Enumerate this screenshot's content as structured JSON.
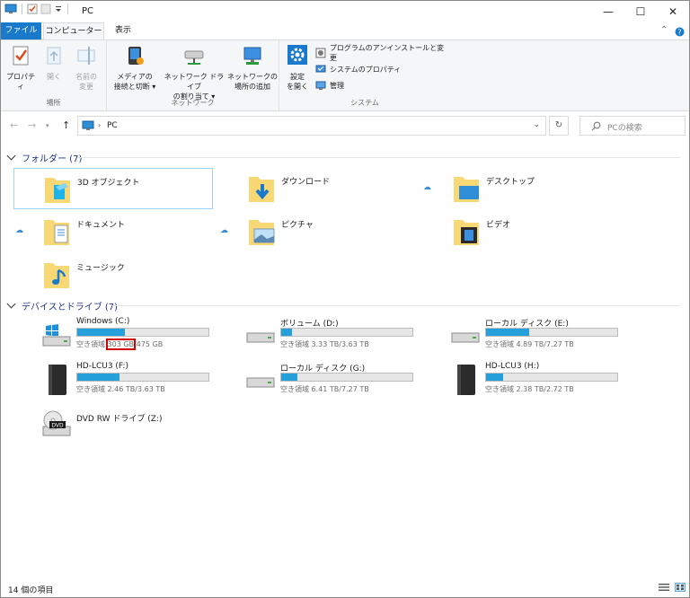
{
  "window": {
    "title": "PC",
    "controls": {
      "minimize": "—",
      "maximize": "☐",
      "close": "✕"
    }
  },
  "ribbon_tabs": {
    "file": "ファイル",
    "computer": "コンピューター",
    "view": "表示"
  },
  "ribbon": {
    "location": {
      "label": "場所",
      "properties": "プロパティ",
      "open": "開く",
      "rename_line1": "名前の",
      "rename_line2": "変更"
    },
    "network": {
      "label": "ネットワーク",
      "media_line1": "メディアの",
      "media_line2": "接続と切断 ▾",
      "map_drive_line1": "ネットワーク ドライブ",
      "map_drive_line2": "の割り当て ▾",
      "add_location_line1": "ネットワークの",
      "add_location_line2": "場所の追加"
    },
    "system": {
      "label": "システム",
      "settings_line1": "設定",
      "settings_line2": "を開く",
      "uninstall": "プログラムのアンインストールと変更",
      "system_properties": "システムのプロパティ",
      "manage": "管理"
    }
  },
  "address": {
    "path": "PC",
    "search_placeholder": "PCの検索"
  },
  "folders_section": {
    "title": "フォルダー (7)"
  },
  "folders": [
    {
      "name": "3D オブジェクト",
      "icon": "3d-objects-folder-icon"
    },
    {
      "name": "ダウンロード",
      "icon": "downloads-folder-icon"
    },
    {
      "name": "デスクトップ",
      "icon": "desktop-folder-icon"
    },
    {
      "name": "ドキュメント",
      "icon": "documents-folder-icon"
    },
    {
      "name": "ピクチャ",
      "icon": "pictures-folder-icon"
    },
    {
      "name": "ビデオ",
      "icon": "videos-folder-icon"
    },
    {
      "name": "ミュージック",
      "icon": "music-folder-icon"
    }
  ],
  "drives_section": {
    "title": "デバイスとドライブ (7)"
  },
  "drives": [
    {
      "name": "Windows (C:)",
      "free_label": "空き領域",
      "free": "303 GB",
      "separator": "/",
      "total": "475 GB",
      "used_fraction": 0.36
    },
    {
      "name": "ボリューム (D:)",
      "info": "空き領域 3.33 TB/3.63 TB",
      "used_fraction": 0.08
    },
    {
      "name": "ローカル ディスク (E:)",
      "info": "空き領域 4.89 TB/7.27 TB",
      "used_fraction": 0.33
    },
    {
      "name": "HD-LCU3 (F:)",
      "info": "空き領域 2.46 TB/3.63 TB",
      "used_fraction": 0.32
    },
    {
      "name": "ローカル ディスク (G:)",
      "info": "空き領域 6.41 TB/7.27 TB",
      "used_fraction": 0.12
    },
    {
      "name": "HD-LCU3 (H:)",
      "info": "空き領域 2.38 TB/2.72 TB",
      "used_fraction": 0.13
    },
    {
      "name": "DVD RW ドライブ (Z:)",
      "dvd_label": "DVD"
    }
  ],
  "status": {
    "items": "14 個の項目"
  },
  "colors": {
    "accent": "#1979ca",
    "bar_fill": "#26a0da",
    "highlight": "#d40000",
    "section_title": "#1e3287"
  }
}
